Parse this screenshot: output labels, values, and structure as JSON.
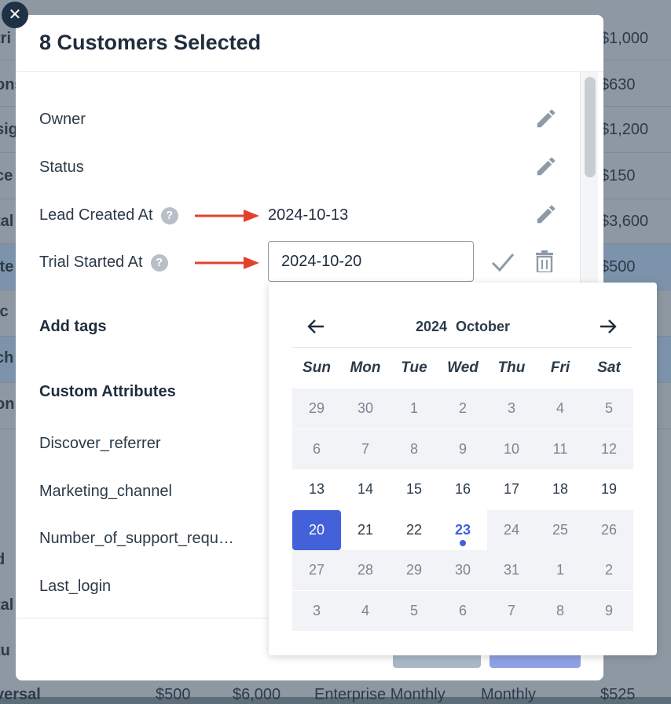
{
  "background": {
    "rows": [
      {
        "name": "tri",
        "price": "$1,000"
      },
      {
        "name": "ons",
        "price": "$630"
      },
      {
        "name": "sig",
        "price": "$1,200"
      },
      {
        "name": "ce",
        "price": "$150"
      },
      {
        "name": "tal",
        "price": "$3,600"
      },
      {
        "name": "ite",
        "price": "$500"
      },
      {
        "name": "ic",
        "price": ""
      },
      {
        "name": "ch",
        "price": ""
      },
      {
        "name": "on",
        "price": ""
      }
    ],
    "lower_names": [
      "d",
      "tal",
      "tu"
    ],
    "last_row": {
      "name": "versal",
      "col1": "$500",
      "col2": "$6,000",
      "col3": "Enterprise Monthly",
      "col4": "Monthly",
      "col5": "$525"
    }
  },
  "modal": {
    "title": "8 Customers Selected",
    "close_label": "✕",
    "fields": {
      "owner": "Owner",
      "status": "Status",
      "lead_created_at": "Lead Created At",
      "lead_created_value": "2024-10-13",
      "trial_started_at": "Trial Started At",
      "trial_started_value": "2024-10-20",
      "help": "?"
    },
    "add_tags": "Add tags",
    "custom_attributes": {
      "heading": "Custom Attributes",
      "items": [
        "Discover_referrer",
        "Marketing_channel",
        "Number_of_support_requ…",
        "Last_login"
      ]
    }
  },
  "calendar": {
    "year": "2024",
    "month": "October",
    "weekdays": [
      "Sun",
      "Mon",
      "Tue",
      "Wed",
      "Thu",
      "Fri",
      "Sat"
    ],
    "weeks": [
      [
        "29",
        "30",
        "1",
        "2",
        "3",
        "4",
        "5"
      ],
      [
        "6",
        "7",
        "8",
        "9",
        "10",
        "11",
        "12"
      ],
      [
        "13",
        "14",
        "15",
        "16",
        "17",
        "18",
        "19"
      ],
      [
        "20",
        "21",
        "22",
        "23",
        "24",
        "25",
        "26"
      ],
      [
        "27",
        "28",
        "29",
        "30",
        "31",
        "1",
        "2"
      ],
      [
        "3",
        "4",
        "5",
        "6",
        "7",
        "8",
        "9"
      ]
    ],
    "selected": "20",
    "today": "23"
  },
  "colors": {
    "accent": "#4361d9",
    "arrow": "#e2412e",
    "icon": "#8f9aa6"
  }
}
